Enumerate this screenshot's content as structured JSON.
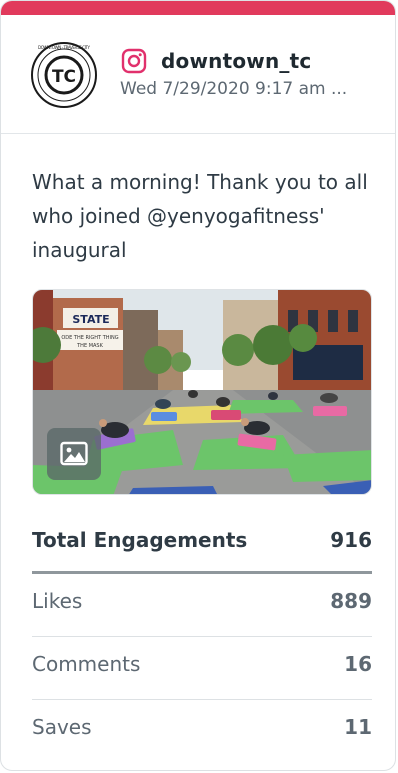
{
  "post": {
    "username": "downtown_tc",
    "timestamp": "Wed 7/29/2020 9:17 am ...",
    "caption": "What a morning! Thank you to all who joined @yenyogafitness' inaugural",
    "avatar_text": {
      "initials": "TC",
      "ring": "DOWNTOWN · TRAVERSE CITY"
    },
    "photo_signs": {
      "theatre": "STATE",
      "marquee_line1": "ODE THE RIGHT THING",
      "marquee_line2": "THE MASK"
    }
  },
  "icons": {
    "platform": "instagram-icon",
    "media": "image-icon"
  },
  "colors": {
    "accent": "#e13a5c",
    "instagram": "#e1306c",
    "text_dark": "#2f3b45",
    "text_muted": "#5d6872"
  },
  "stats": {
    "total": {
      "label": "Total Engagements",
      "value": "916"
    },
    "rows": [
      {
        "label": "Likes",
        "value": "889"
      },
      {
        "label": "Comments",
        "value": "16"
      },
      {
        "label": "Saves",
        "value": "11"
      }
    ]
  }
}
